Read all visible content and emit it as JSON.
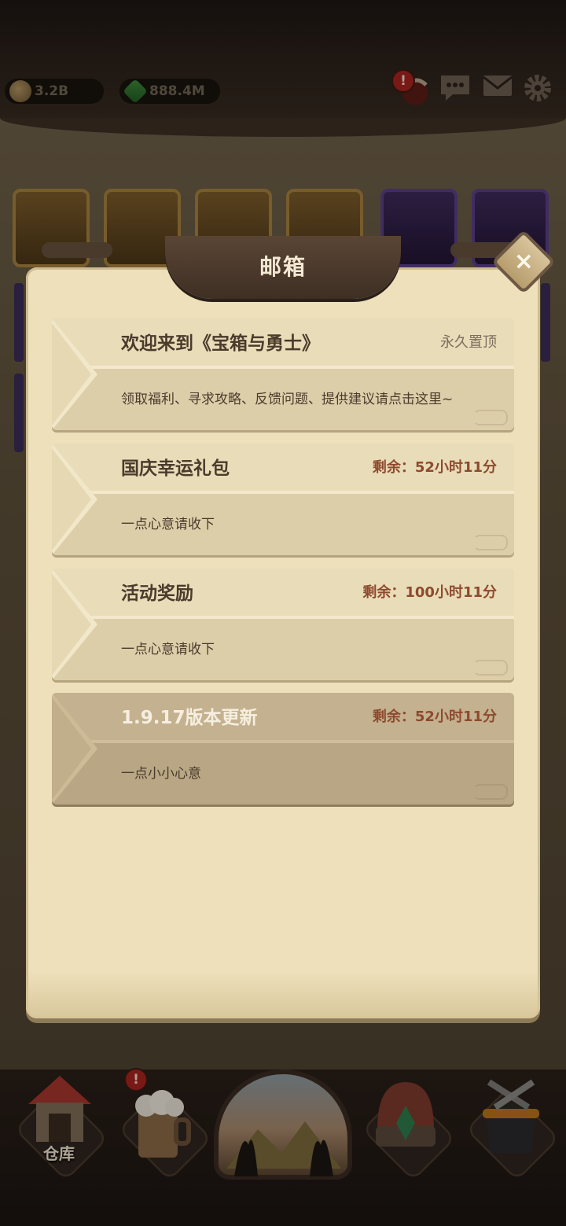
{
  "hud": {
    "coins": "3.2B",
    "gems": "888.4M",
    "alert_mark": "!"
  },
  "dialog": {
    "title": "邮箱",
    "close_symbol": "×"
  },
  "mails": [
    {
      "title": "欢迎来到《宝箱与勇士》",
      "status": "永久置顶",
      "body": "领取福利、寻求攻略、反馈问题、提供建议请点击这里~",
      "read": false
    },
    {
      "title": "国庆幸运礼包",
      "status": "剩余：52小时11分",
      "body": "一点心意请收下",
      "read": false
    },
    {
      "title": "活动奖励",
      "status": "剩余：100小时11分",
      "body": "一点心意请收下",
      "read": false
    },
    {
      "title": "1.9.17版本更新",
      "status": "剩余：52小时11分",
      "body": "一点小小心意",
      "read": true
    }
  ],
  "bottom_nav": {
    "warehouse_label": "仓库",
    "tavern_alert": "!"
  },
  "icons": {
    "coin": "coin-icon",
    "gem": "gem-icon",
    "chat": "chat-icon",
    "mail": "mail-icon",
    "settings": "gear-icon",
    "close": "close-icon"
  }
}
